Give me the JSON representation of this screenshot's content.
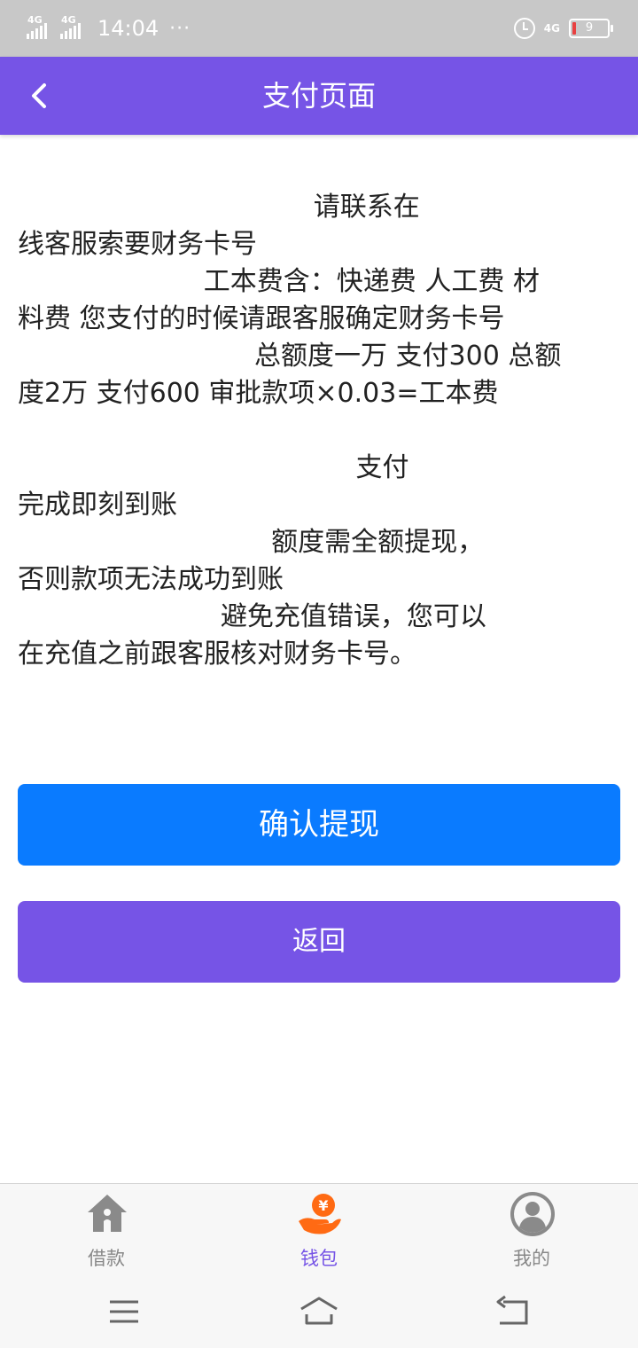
{
  "status_bar": {
    "time": "14:04",
    "dots": "···",
    "network_left_1": "4G",
    "network_left_2": "4G",
    "network_right": "4G",
    "battery_level": "9"
  },
  "header": {
    "title": "支付页面",
    "back_icon": "chevron-left-icon"
  },
  "notice_lines": [
    "                                   请联系在",
    "线客服索要财务卡号",
    "                      工本费含：快递费 人工费 材",
    "料费 您支付的时候请跟客服确定财务卡号",
    "                            总额度一万 支付300 总额",
    "度2万 支付600 审批款项×0.03=工本费",
    "",
    "                                        支付",
    "完成即刻到账",
    "                              额度需全额提现，",
    "否则款项无法成功到账",
    "                        避免充值错误，您可以",
    "在充值之前跟客服核对财务卡号。"
  ],
  "buttons": {
    "confirm_label": "确认提现",
    "back_label": "返回"
  },
  "tabs": [
    {
      "label": "借款",
      "icon": "house-icon",
      "active": false
    },
    {
      "label": "钱包",
      "icon": "wallet-yen-icon",
      "active": true
    },
    {
      "label": "我的",
      "icon": "user-avatar-icon",
      "active": false
    }
  ],
  "colors": {
    "primary": "#7654e6",
    "confirm": "#0a7bff",
    "tab_active_icon": "#ff6a13"
  }
}
